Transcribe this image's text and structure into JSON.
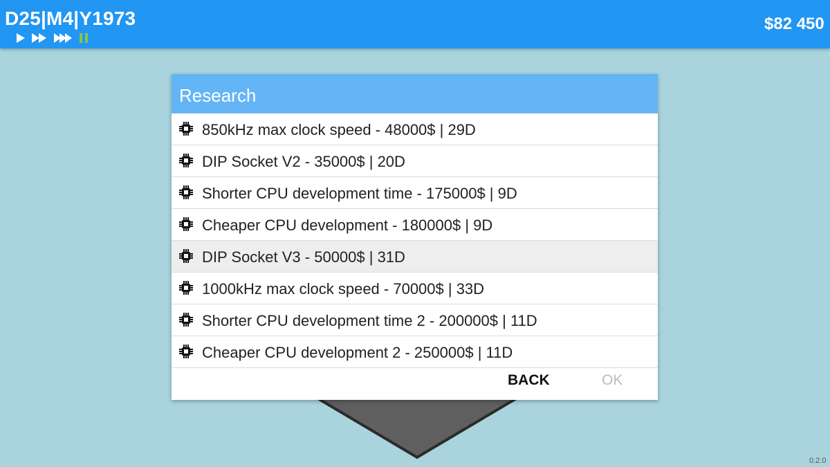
{
  "header": {
    "date": "D25|M4|Y1973",
    "money": "$82 450",
    "speed_controls": [
      {
        "name": "play-icon",
        "active": false
      },
      {
        "name": "fast-forward-icon",
        "active": false
      },
      {
        "name": "fastest-forward-icon",
        "active": false
      },
      {
        "name": "pause-icon",
        "active": true
      }
    ]
  },
  "dialog": {
    "title": "Research",
    "items": [
      {
        "icon": "cpu-chip-icon",
        "label": "850kHz max clock speed - 48000$ | 29D",
        "selected": false
      },
      {
        "icon": "cpu-chip-icon",
        "label": "DIP Socket V2 - 35000$ | 20D",
        "selected": false
      },
      {
        "icon": "cpu-chip-icon",
        "label": "Shorter CPU development time - 175000$ | 9D",
        "selected": false
      },
      {
        "icon": "cpu-chip-icon",
        "label": "Cheaper CPU development - 180000$ | 9D",
        "selected": false
      },
      {
        "icon": "cpu-chip-icon",
        "label": "DIP Socket V3 - 50000$ | 31D",
        "selected": true
      },
      {
        "icon": "cpu-chip-icon",
        "label": "1000kHz max clock speed - 70000$ | 33D",
        "selected": false
      },
      {
        "icon": "cpu-chip-icon",
        "label": "Shorter CPU development time 2 - 200000$ | 11D",
        "selected": false
      },
      {
        "icon": "cpu-chip-icon",
        "label": "Cheaper CPU development 2 - 250000$ | 11D",
        "selected": false
      }
    ],
    "back_label": "BACK",
    "ok_label": "OK"
  },
  "version": "0.2.0",
  "colors": {
    "background": "#a9d4de",
    "topbar": "#2196f3",
    "dialog_header": "#64b5f6",
    "pause_active": "#8bc34a",
    "selected_row": "#eeeeee",
    "ok_disabled": "#bdbdbd"
  }
}
